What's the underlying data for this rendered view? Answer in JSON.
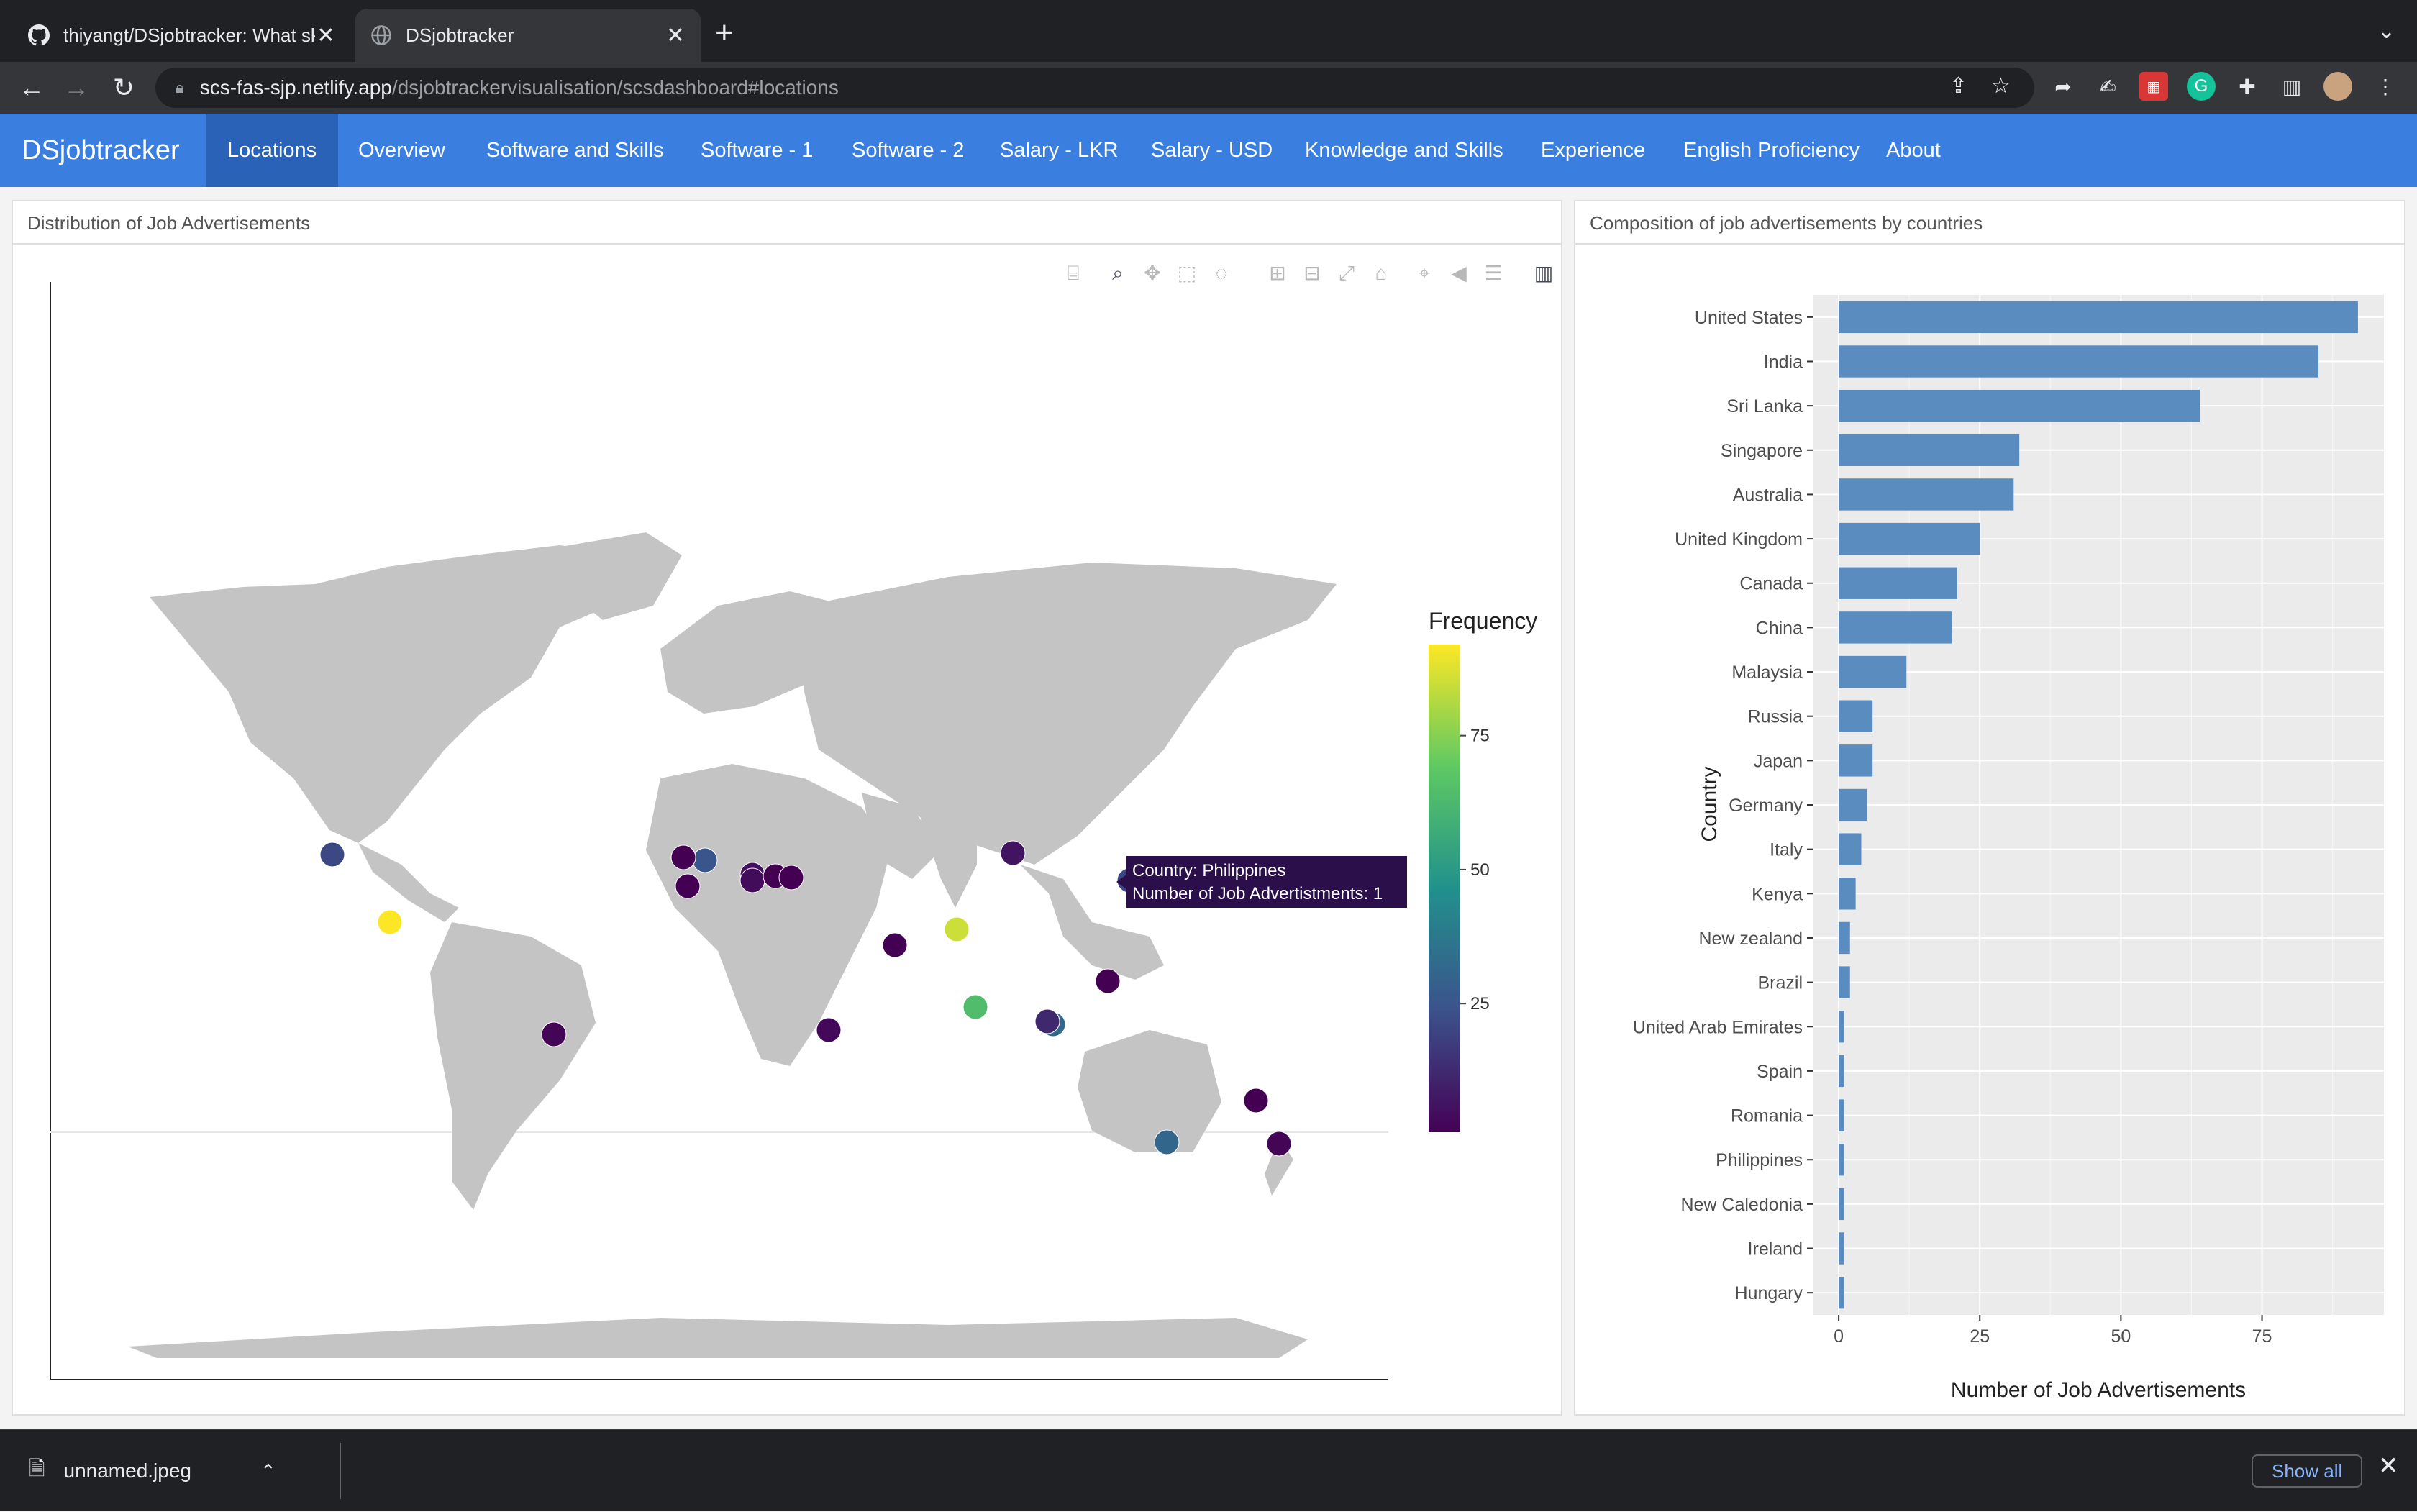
{
  "browser": {
    "tabs": [
      {
        "title": "thiyangt/DSjobtracker: What sk",
        "icon": "github-icon",
        "active": false
      },
      {
        "title": "DSjobtracker",
        "icon": "globe-icon",
        "active": true
      }
    ],
    "url_host": "scs-fas-sjp.netlify.app",
    "url_path": "/dsjobtrackervisualisation/scsdashboard#locations"
  },
  "navbar": {
    "brand": "DSjobtracker",
    "items": [
      "Locations",
      "Overview",
      "Software and Skills",
      "Software - 1",
      "Software - 2",
      "Salary - LKR",
      "Salary - USD",
      "Knowledge and Skills",
      "Experience",
      "English Proficiency",
      "About"
    ],
    "active_index": 0,
    "color": "#3a7fe0"
  },
  "left_panel": {
    "title": "Distribution of Job Advertisements",
    "colorbar_title": "Frequency",
    "colorbar_ticks": [
      "75",
      "50",
      "25"
    ],
    "tooltip_line1": "Country: Philippines",
    "tooltip_line2": "Number of Job Advertistments: 1"
  },
  "right_panel": {
    "title": "Composition of job advertisements by countries"
  },
  "chart_data": [
    {
      "type": "scatter",
      "subtype": "geo-bubble",
      "colorbar": {
        "title": "Frequency",
        "ticks": [
          25,
          50,
          75
        ],
        "colorscale": "viridis",
        "range": [
          1,
          92
        ]
      },
      "points": [
        {
          "country": "United States",
          "frequency": 92
        },
        {
          "country": "India",
          "frequency": 85
        },
        {
          "country": "Sri Lanka",
          "frequency": 64
        },
        {
          "country": "Singapore",
          "frequency": 32
        },
        {
          "country": "Australia",
          "frequency": 31
        },
        {
          "country": "United Kingdom",
          "frequency": 25
        },
        {
          "country": "Canada",
          "frequency": 21
        },
        {
          "country": "China",
          "frequency": 20
        },
        {
          "country": "Malaysia",
          "frequency": 12
        },
        {
          "country": "Russia",
          "frequency": 6
        },
        {
          "country": "Japan",
          "frequency": 6
        },
        {
          "country": "Germany",
          "frequency": 5
        },
        {
          "country": "Italy",
          "frequency": 4
        },
        {
          "country": "Kenya",
          "frequency": 3
        },
        {
          "country": "New zealand",
          "frequency": 2
        },
        {
          "country": "Brazil",
          "frequency": 2
        },
        {
          "country": "United Arab Emirates",
          "frequency": 1
        },
        {
          "country": "Spain",
          "frequency": 1
        },
        {
          "country": "Romania",
          "frequency": 1
        },
        {
          "country": "Philippines",
          "frequency": 1
        },
        {
          "country": "New Caledonia",
          "frequency": 1
        },
        {
          "country": "Ireland",
          "frequency": 1
        },
        {
          "country": "Hungary",
          "frequency": 1
        }
      ]
    },
    {
      "type": "bar",
      "orientation": "horizontal",
      "categories": [
        "United States",
        "India",
        "Sri Lanka",
        "Singapore",
        "Australia",
        "United Kingdom",
        "Canada",
        "China",
        "Malaysia",
        "Russia",
        "Japan",
        "Germany",
        "Italy",
        "Kenya",
        "New zealand",
        "Brazil",
        "United Arab Emirates",
        "Spain",
        "Romania",
        "Philippines",
        "New Caledonia",
        "Ireland",
        "Hungary"
      ],
      "values": [
        92,
        85,
        64,
        32,
        31,
        25,
        21,
        20,
        12,
        6,
        6,
        5,
        4,
        3,
        2,
        2,
        1,
        1,
        1,
        1,
        1,
        1,
        1
      ],
      "xlabel": "Number of Job Advertisements",
      "ylabel": "Country",
      "xticks": [
        0,
        25,
        50,
        75
      ],
      "xlim": [
        -4.6,
        96.6
      ],
      "bar_color": "#5b8cc0",
      "grid": true
    }
  ],
  "downloads": {
    "filename": "unnamed.jpeg",
    "show_all": "Show all"
  }
}
